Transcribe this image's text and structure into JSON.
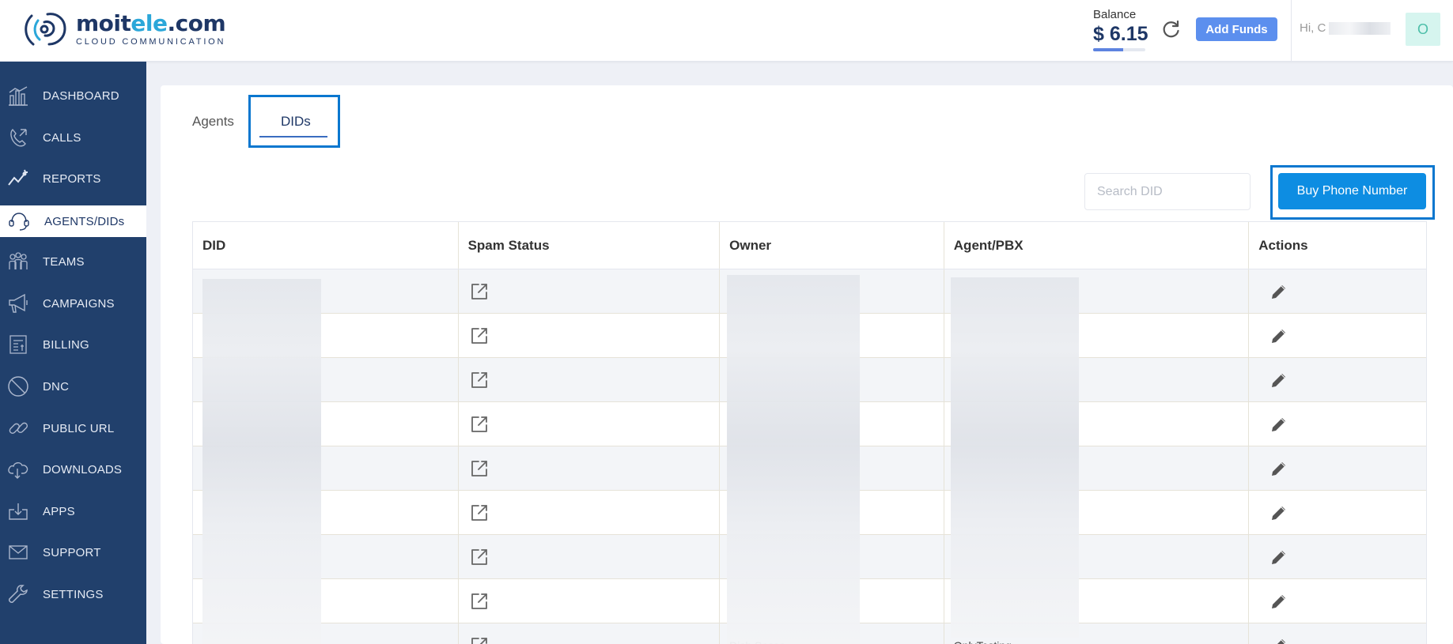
{
  "brand": {
    "name_prefix": "moit",
    "name_accent": "ele",
    "name_suffix": ".com",
    "tagline": "CLOUD COMMUNICATION"
  },
  "header": {
    "balance_label": "Balance",
    "balance_amount": "$ 6.15",
    "balance_fraction": 0.58,
    "add_funds_label": "Add Funds",
    "greeting": "Hi, C",
    "avatar_letter": "O"
  },
  "sidebar": {
    "items": [
      {
        "label": "DASHBOARD",
        "icon": "dashboard-icon"
      },
      {
        "label": "CALLS",
        "icon": "calls-icon"
      },
      {
        "label": "REPORTS",
        "icon": "reports-icon"
      },
      {
        "label": "AGENTS/DIDs",
        "icon": "agents-icon",
        "active": true
      },
      {
        "label": "TEAMS",
        "icon": "teams-icon"
      },
      {
        "label": "CAMPAIGNS",
        "icon": "megaphone-icon"
      },
      {
        "label": "BILLING",
        "icon": "billing-icon"
      },
      {
        "label": "DNC",
        "icon": "block-icon"
      },
      {
        "label": "PUBLIC URL",
        "icon": "link-icon"
      },
      {
        "label": "DOWNLOADS",
        "icon": "cloud-download-icon"
      },
      {
        "label": "APPS",
        "icon": "apps-icon"
      },
      {
        "label": "SUPPORT",
        "icon": "mail-icon"
      },
      {
        "label": "SETTINGS",
        "icon": "wrench-icon"
      }
    ]
  },
  "tabs": {
    "agents": "Agents",
    "dids": "DIDs",
    "active": "DIDs"
  },
  "search": {
    "placeholder": "Search DID"
  },
  "buy_button": {
    "label": "Buy Phone Number"
  },
  "table": {
    "columns": [
      "DID",
      "Spam Status",
      "Owner",
      "Agent/PBX",
      "Actions"
    ],
    "rows": 9,
    "partial_row": {
      "owner": "Dish Sesso",
      "agent": "OnlyTesting"
    }
  },
  "colors": {
    "sidebar": "#21406c",
    "accent": "#0d8de2",
    "highlight": "#0a77cf",
    "add_funds": "#5c8fee"
  }
}
